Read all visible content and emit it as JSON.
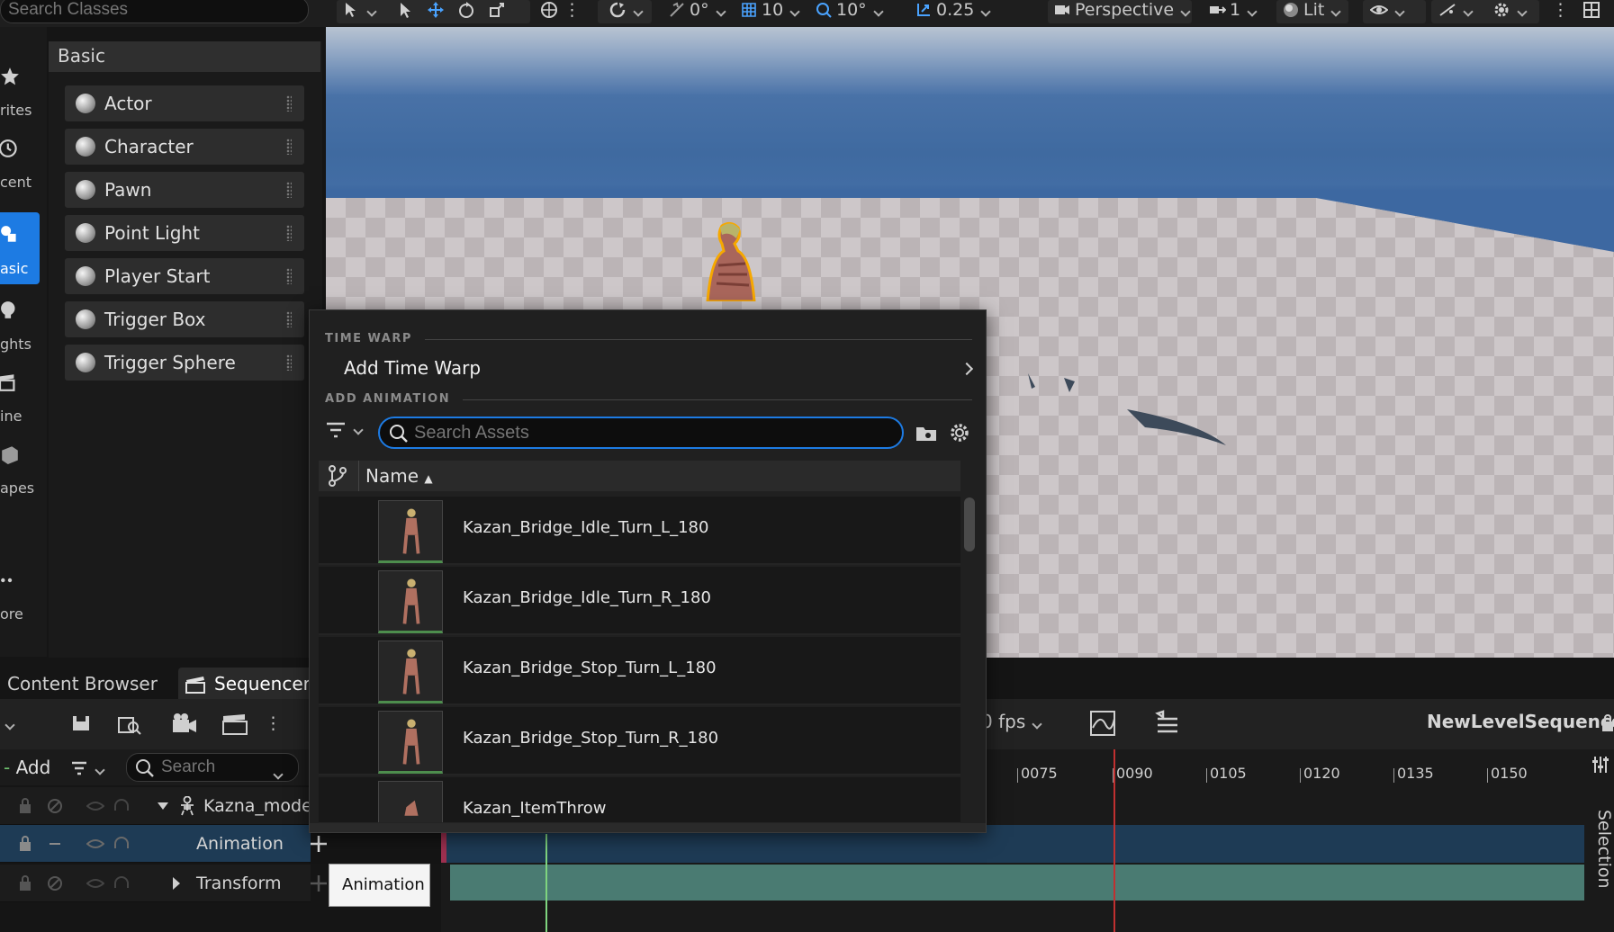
{
  "top_toolbar": {
    "search_placeholder": "Search Classes",
    "snap_translate": "0°",
    "grid_size": "10",
    "rotation_snap": "10°",
    "scale_snap": "0.25",
    "view_mode": "Perspective",
    "camera_speed": "1",
    "lighting_mode": "Lit"
  },
  "categories": [
    {
      "label": "rites",
      "icon": "star-icon"
    },
    {
      "label": "cent",
      "icon": "clock-icon"
    },
    {
      "label": "asic",
      "icon": "shapes-icon"
    },
    {
      "label": "ghts",
      "icon": "bulb-icon"
    },
    {
      "label": "ine",
      "icon": "clapper-icon"
    },
    {
      "label": "apes",
      "icon": "cube-icon"
    },
    {
      "label": "ore",
      "icon": "more-icon"
    }
  ],
  "place_actors": {
    "section": "Basic",
    "items": [
      "Actor",
      "Character",
      "Pawn",
      "Point Light",
      "Player Start",
      "Trigger Box",
      "Trigger Sphere"
    ]
  },
  "bottom_tabs": {
    "content_browser": "Content Browser",
    "sequencer": "Sequencer*"
  },
  "sequencer": {
    "fps": "0 fps",
    "sequence_name": "NewLevelSequence*",
    "add_label": "Add",
    "search_placeholder": "Search",
    "tracks": [
      {
        "name": "Kazna_mode"
      },
      {
        "name": "Animation"
      },
      {
        "name": "Transform"
      }
    ],
    "ruler": [
      "0075",
      "0090",
      "0105",
      "0120",
      "0135",
      "0150"
    ],
    "side_tab": "Selection"
  },
  "popup": {
    "time_warp_header": "TIME WARP",
    "add_time_warp": "Add Time Warp",
    "add_animation_header": "ADD ANIMATION",
    "search_placeholder": "Search Assets",
    "column_name": "Name",
    "assets": [
      "Kazan_Bridge_Idle_Turn_L_180",
      "Kazan_Bridge_Idle_Turn_R_180",
      "Kazan_Bridge_Stop_Turn_L_180",
      "Kazan_Bridge_Stop_Turn_R_180",
      "Kazan_ItemThrow"
    ]
  },
  "tooltip": {
    "text": "Animation"
  },
  "colors": {
    "accent": "#1d7be3",
    "playhead": "#c03030",
    "anim_track": "#1e3b55",
    "transform_track": "#4a7b72"
  }
}
